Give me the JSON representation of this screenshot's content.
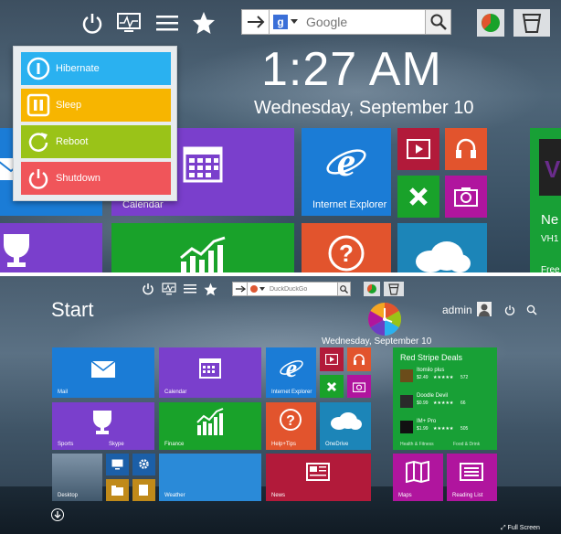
{
  "top": {
    "search": {
      "engine_letter": "g",
      "placeholder": "Google",
      "engine_color": "#3a6fd8"
    },
    "power_menu": [
      {
        "label": "Hibernate",
        "color": "#2ab1f0"
      },
      {
        "label": "Sleep",
        "color": "#f7b500"
      },
      {
        "label": "Reboot",
        "color": "#9ac318"
      },
      {
        "label": "Shutdown",
        "color": "#f0555a"
      }
    ],
    "clock": "1:27 AM",
    "date": "Wednesday, September 10",
    "tiles": {
      "calendar": "Calendar",
      "internet_explorer": "Internet Explorer",
      "vh1_partial": "Ne",
      "vh1_sub": "VH1",
      "free_partial": "Free"
    }
  },
  "bottom": {
    "search": {
      "placeholder": "DuckDuckGo"
    },
    "start_title": "Start",
    "user": "admin",
    "date": "Wednesday, September 10",
    "tiles": {
      "mail": "Mail",
      "calendar": "Calendar",
      "internet_explorer": "Internet Explorer",
      "sports": "Sports",
      "skype": "Skype",
      "finance": "Finance",
      "help_tips": "Help+Tips",
      "onedrive": "OneDrive",
      "desktop": "Desktop",
      "weather": "Weather",
      "news": "News",
      "maps": "Maps",
      "reading_list": "Reading List",
      "health_fitness": "Health & Fitness",
      "food_drink": "Food & Drink"
    },
    "store": {
      "title": "Red Stripe Deals",
      "items": [
        {
          "name": "Itomilo plus",
          "price": "$2.49",
          "stars": "★★★★★",
          "count": "572"
        },
        {
          "name": "Doodle Devil",
          "price": "$0.99",
          "stars": "★★★★★",
          "count": "66"
        },
        {
          "name": "IM+ Pro",
          "price": "$1.99",
          "stars": "★★★★★",
          "count": "505"
        }
      ]
    },
    "fullscreen": "Full Screen"
  },
  "colors": {
    "blue": "#1b7cd6",
    "purple": "#6b3ec4",
    "green": "#19a22a",
    "orange": "#e2542d",
    "darkred": "#b21a3a",
    "teal": "#1c85b8",
    "magenta": "#b0159e",
    "store_green": "#18a036"
  },
  "icons": [
    "power-icon",
    "monitor-icon",
    "menu-icon",
    "star-icon",
    "arrow-right-icon",
    "search-icon",
    "pie-icon",
    "trash-icon"
  ]
}
